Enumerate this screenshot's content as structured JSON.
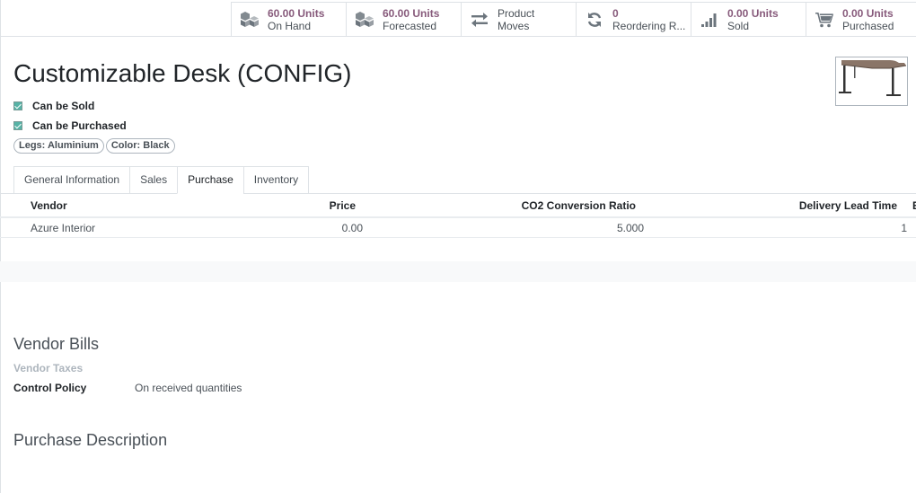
{
  "stats": [
    {
      "value": "60.00 Units",
      "label": "On Hand",
      "icon": "cubes-icon",
      "name": "stat-on-hand"
    },
    {
      "value": "60.00 Units",
      "label": "Forecasted",
      "icon": "cubes-icon",
      "name": "stat-forecasted"
    },
    {
      "value": "Product",
      "label": "Moves",
      "icon": "exchange-icon",
      "name": "stat-product-moves"
    },
    {
      "value": "0",
      "label": "Reordering R...",
      "icon": "refresh-icon",
      "name": "stat-reordering-rules"
    },
    {
      "value": "0.00 Units",
      "label": "Sold",
      "icon": "signal-icon",
      "name": "stat-sold"
    },
    {
      "value": "0.00 Units",
      "label": "Purchased",
      "icon": "cart-icon",
      "name": "stat-purchased"
    }
  ],
  "product": {
    "title": "Customizable Desk (CONFIG)",
    "can_be_sold": "Can be Sold",
    "can_be_purchased": "Can be Purchased",
    "tags": [
      "Legs: Aluminium",
      "Color: Black"
    ]
  },
  "tabs": [
    "General Information",
    "Sales",
    "Purchase",
    "Inventory"
  ],
  "active_tab": "Purchase",
  "vendor_table": {
    "headers": [
      "Vendor",
      "Price",
      "CO2 Conversion Ratio",
      "Delivery Lead Time"
    ],
    "rows": [
      {
        "vendor": "Azure Interior",
        "price": "0.00",
        "co2": "5.000",
        "lead_time": "1"
      }
    ]
  },
  "vendor_bills": {
    "title": "Vendor Bills",
    "vendor_taxes_label": "Vendor Taxes",
    "control_policy_label": "Control Policy",
    "control_policy_value": "On received quantities"
  },
  "purchase_description": {
    "title": "Purchase Description"
  },
  "colors": {
    "accent": "#875a7b",
    "checkbox": "#56b3a6"
  }
}
